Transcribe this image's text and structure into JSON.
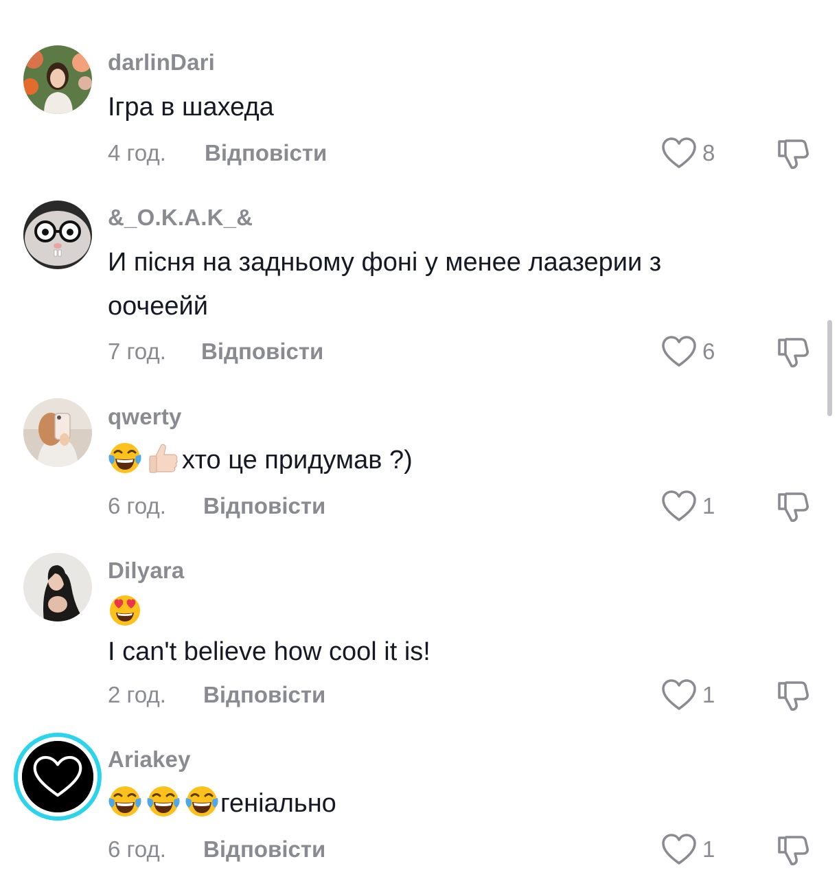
{
  "comments": [
    {
      "username": "darlinDari",
      "text": "Ігра в шахеда",
      "time": "4 год.",
      "reply": "Відповісти",
      "likes": "8"
    },
    {
      "username": "&_O.K.A.K_&",
      "text": "И пісня на задньому фоні у менее лаазерии з оочеейй",
      "time": "7 год.",
      "reply": "Відповісти",
      "likes": "6"
    },
    {
      "username": "qwerty",
      "text": "хто це придумав ?)",
      "time": "6 год.",
      "reply": "Відповісти",
      "likes": "1",
      "emoji": [
        "tears-of-joy",
        "thumbs-up"
      ]
    },
    {
      "username": "Dilyara",
      "text": "I can't believe how cool it is!",
      "time": "2 год.",
      "reply": "Відповісти",
      "likes": "1",
      "emoji": [
        "heart-eyes"
      ]
    },
    {
      "username": "Ariakey",
      "text": "геніально",
      "time": "6 год.",
      "reply": "Відповісти",
      "likes": "1",
      "emoji": [
        "tears-of-joy",
        "tears-of-joy",
        "tears-of-joy"
      ]
    }
  ],
  "colors": {
    "text": "#161823",
    "secondary": "#8a8b91",
    "story_ring": "#2bd3ec",
    "scrollbar": "#c8c8cc"
  }
}
